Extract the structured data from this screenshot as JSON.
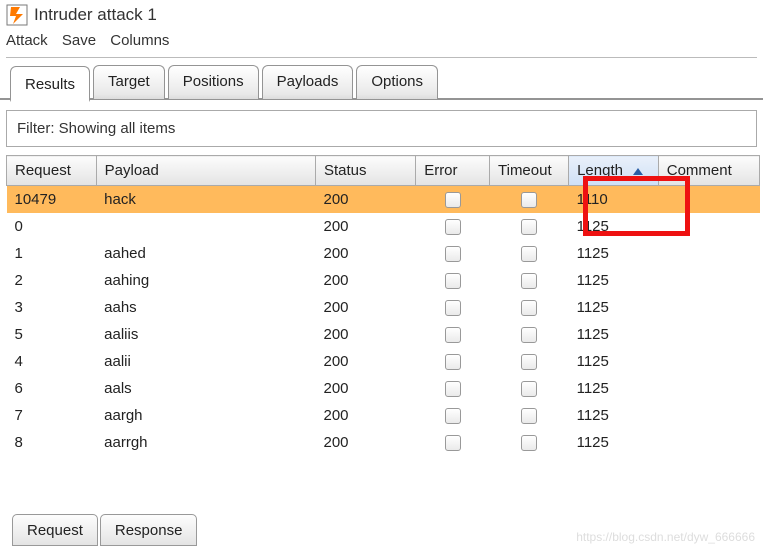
{
  "window": {
    "title": "Intruder attack 1"
  },
  "menu": {
    "items": [
      "Attack",
      "Save",
      "Columns"
    ]
  },
  "tabs": {
    "items": [
      "Results",
      "Target",
      "Positions",
      "Payloads",
      "Options"
    ],
    "active_index": 0
  },
  "filter": {
    "text": "Filter: Showing all items"
  },
  "table": {
    "columns": [
      "Request",
      "Payload",
      "Status",
      "Error",
      "Timeout",
      "Length",
      "Comment"
    ],
    "sort_column": "Length",
    "sort_dir": "asc",
    "selected_index": 0,
    "rows": [
      {
        "request": "10479",
        "payload": "hack",
        "status": "200",
        "error": false,
        "timeout": false,
        "length": "1110",
        "comment": ""
      },
      {
        "request": "0",
        "payload": "",
        "status": "200",
        "error": false,
        "timeout": false,
        "length": "1125",
        "comment": ""
      },
      {
        "request": "1",
        "payload": "aahed",
        "status": "200",
        "error": false,
        "timeout": false,
        "length": "1125",
        "comment": ""
      },
      {
        "request": "2",
        "payload": "aahing",
        "status": "200",
        "error": false,
        "timeout": false,
        "length": "1125",
        "comment": ""
      },
      {
        "request": "3",
        "payload": "aahs",
        "status": "200",
        "error": false,
        "timeout": false,
        "length": "1125",
        "comment": ""
      },
      {
        "request": "5",
        "payload": "aaliis",
        "status": "200",
        "error": false,
        "timeout": false,
        "length": "1125",
        "comment": ""
      },
      {
        "request": "4",
        "payload": "aalii",
        "status": "200",
        "error": false,
        "timeout": false,
        "length": "1125",
        "comment": ""
      },
      {
        "request": "6",
        "payload": "aals",
        "status": "200",
        "error": false,
        "timeout": false,
        "length": "1125",
        "comment": ""
      },
      {
        "request": "7",
        "payload": "aargh",
        "status": "200",
        "error": false,
        "timeout": false,
        "length": "1125",
        "comment": ""
      },
      {
        "request": "8",
        "payload": "aarrgh",
        "status": "200",
        "error": false,
        "timeout": false,
        "length": "1125",
        "comment": ""
      }
    ]
  },
  "bottom_tabs": {
    "items": [
      "Request",
      "Response"
    ]
  },
  "watermark": "https://blog.csdn.net/dyw_666666"
}
